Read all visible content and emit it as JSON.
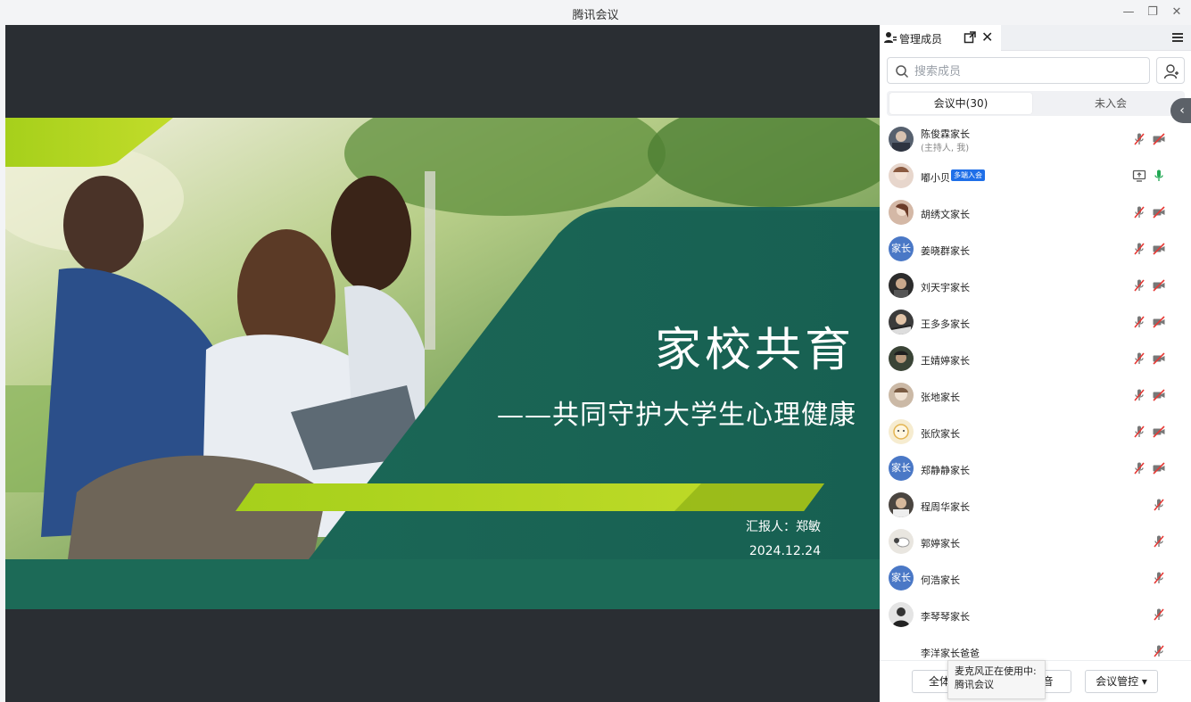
{
  "window": {
    "title": "腾讯会议",
    "minimize": "—",
    "restore": "❐",
    "close": "✕"
  },
  "slide": {
    "title": "家校共育",
    "subtitle": "——共同守护大学生心理健康",
    "presenter": "汇报人：郑敏",
    "date": "2024.12.24",
    "colors": {
      "dark_green": "#1f6b5c",
      "lime": "#a8d21e",
      "stage": "#2a2e33"
    }
  },
  "panel": {
    "tab_label": "管理成员",
    "close_label": "✕",
    "search_placeholder": "搜索成员",
    "segments": {
      "in_meeting": "会议中(30)",
      "not_joined": "未入会"
    },
    "collapse_label": "‹",
    "members": [
      {
        "name": "陈俊霖家长",
        "sub": "(主持人, 我)",
        "avatar": "photo",
        "mic": "muted",
        "cam": "off"
      },
      {
        "name": "嘟小贝",
        "badge": "多端入会",
        "avatar": "photo",
        "mic": "on",
        "cam": "screen"
      },
      {
        "name": "胡绣文家长",
        "avatar": "photo",
        "mic": "muted",
        "cam": "off"
      },
      {
        "name": "姜晓群家长",
        "avatar_text": "家长",
        "mic": "muted",
        "cam": "off"
      },
      {
        "name": "刘天宇家长",
        "avatar": "photo",
        "mic": "muted",
        "cam": "off"
      },
      {
        "name": "王多多家长",
        "avatar": "photo",
        "mic": "muted",
        "cam": "off"
      },
      {
        "name": "王婧婷家长",
        "avatar": "photo",
        "mic": "muted",
        "cam": "off"
      },
      {
        "name": "张地家长",
        "avatar": "photo",
        "mic": "muted",
        "cam": "off"
      },
      {
        "name": "张欣家长",
        "avatar": "photo",
        "mic": "muted",
        "cam": "off"
      },
      {
        "name": "郑静静家长",
        "avatar_text": "家长",
        "mic": "muted",
        "cam": "off"
      },
      {
        "name": "程周华家长",
        "avatar": "photo",
        "mic": "muted"
      },
      {
        "name": "郭婷家长",
        "avatar": "photo",
        "mic": "muted"
      },
      {
        "name": "何浩家长",
        "avatar_text": "家长",
        "mic": "muted"
      },
      {
        "name": "李琴琴家长",
        "avatar": "photo",
        "mic": "muted"
      },
      {
        "name": "李洋家长爸爸",
        "avatar": "none",
        "mic": "muted"
      }
    ],
    "buttons": {
      "mute_all": "全体静音",
      "unmute": "静音",
      "control": "会议管控 ▾"
    },
    "tooltip": {
      "line1": "麦克风正在使用中:",
      "line2": "腾讯会议"
    }
  }
}
